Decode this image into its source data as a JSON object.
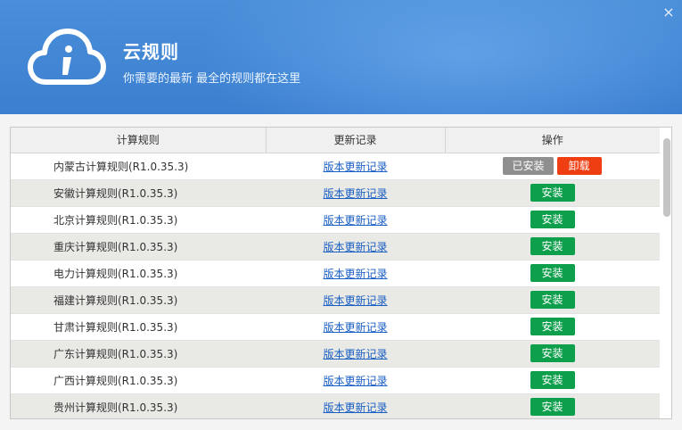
{
  "header": {
    "title": "云规则",
    "subtitle": "你需要的最新 最全的规则都在这里",
    "close_glyph": "×",
    "logo_icon": "cloud-info-icon"
  },
  "table": {
    "columns": [
      "计算规则",
      "更新记录",
      "操作"
    ],
    "link_label": "版本更新记录",
    "install_label": "安装",
    "installed_label": "已安装",
    "uninstall_label": "卸载",
    "rows": [
      {
        "name": "内蒙古计算规则(R1.0.35.3)",
        "status": "installed"
      },
      {
        "name": "安徽计算规则(R1.0.35.3)",
        "status": "install"
      },
      {
        "name": "北京计算规则(R1.0.35.3)",
        "status": "install"
      },
      {
        "name": "重庆计算规则(R1.0.35.3)",
        "status": "install"
      },
      {
        "name": "电力计算规则(R1.0.35.3)",
        "status": "install"
      },
      {
        "name": "福建计算规则(R1.0.35.3)",
        "status": "install"
      },
      {
        "name": "甘肃计算规则(R1.0.35.3)",
        "status": "install"
      },
      {
        "name": "广东计算规则(R1.0.35.3)",
        "status": "install"
      },
      {
        "name": "广西计算规则(R1.0.35.3)",
        "status": "install"
      },
      {
        "name": "贵州计算规则(R1.0.35.3)",
        "status": "install"
      }
    ]
  },
  "colors": {
    "install": "#0e9f4c",
    "installed": "#8f8f8f",
    "uninstall": "#ef3e12",
    "header": "#3b7fd0"
  }
}
